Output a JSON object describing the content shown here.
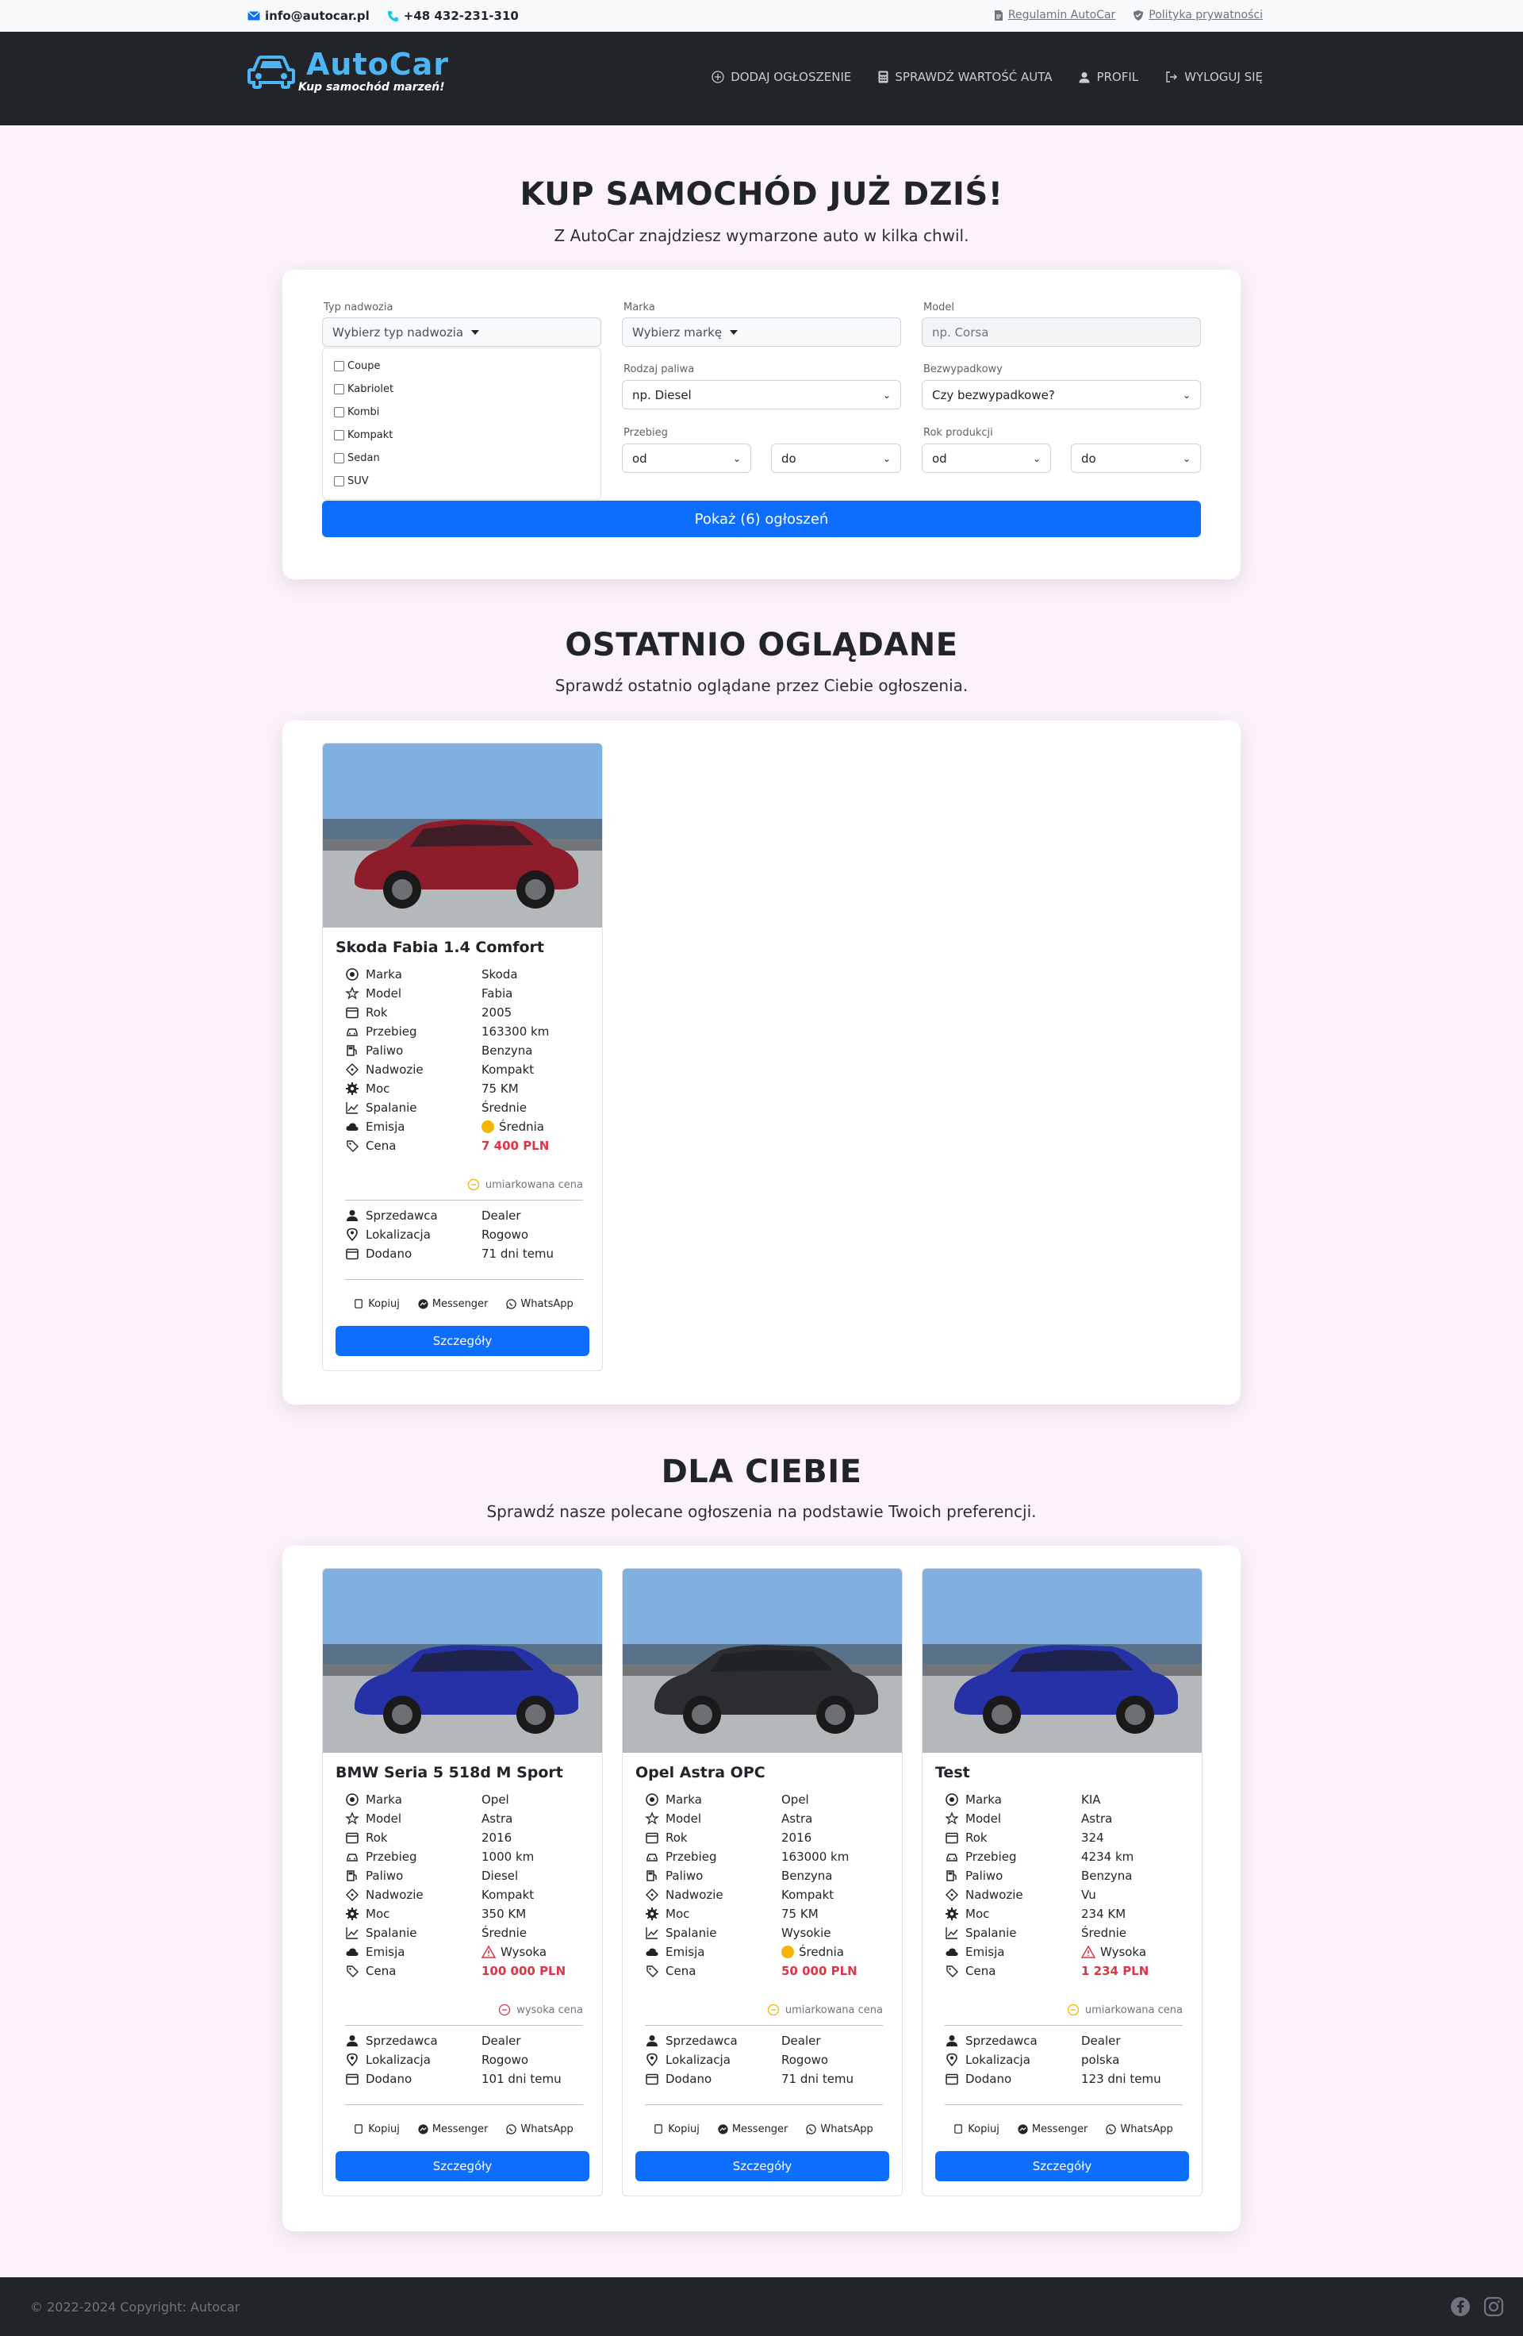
{
  "topbar": {
    "email": "info@autocar.pl",
    "phone": "+48 432-231-310",
    "terms": "Regulamin AutoCar",
    "privacy": "Polityka prywatności"
  },
  "brand": {
    "name": "AutoCar",
    "tagline": "Kup samochód marzeń!",
    "accent": "#4cb5f5"
  },
  "nav": {
    "add": "DODAJ OGŁOSZENIE",
    "value": "SPRAWDŹ WARTOŚĆ AUTA",
    "profile": "PROFIL",
    "logout": "WYLOGUJ SIĘ"
  },
  "hero": {
    "title": "KUP SAMOCHÓD JUŻ DZIŚ!",
    "subtitle": "Z AutoCar znajdziesz wymarzone auto w kilka chwil."
  },
  "search": {
    "body_label": "Typ nadwozia",
    "body_value": "Wybierz typ nadwozia",
    "body_options": [
      "Coupe",
      "Kabriolet",
      "Kombi",
      "Kompakt",
      "Sedan",
      "SUV"
    ],
    "brand_label": "Marka",
    "brand_value": "Wybierz markę",
    "model_label": "Model",
    "model_placeholder": "np. Corsa",
    "fuel_label": "Rodzaj paliwa",
    "fuel_value": "np. Diesel",
    "accident_label": "Bezwypadkowy",
    "accident_value": "Czy bezwypadkowe?",
    "mileage_label": "Przebieg",
    "mileage_from": "od",
    "mileage_to": "do",
    "year_label": "Rok produkcji",
    "year_from": "od",
    "year_to": "do",
    "submit": "Pokaż (6) ogłoszeń"
  },
  "recent": {
    "title": "OSTATNIO OGLĄDANE",
    "subtitle": "Sprawdź ostatnio oglądane przez Ciebie ogłoszenia."
  },
  "foryou": {
    "title": "DLA CIEBIE",
    "subtitle": "Sprawdź nasze polecane ogłoszenia na podstawie Twoich preferencji."
  },
  "labels": {
    "marka": "Marka",
    "model": "Model",
    "rok": "Rok",
    "przebieg": "Przebieg",
    "paliwo": "Paliwo",
    "nadwozie": "Nadwozie",
    "moc": "Moc",
    "spalanie": "Spalanie",
    "emisja": "Emisja",
    "cena": "Cena",
    "sprzedawca": "Sprzedawca",
    "lokalizacja": "Lokalizacja",
    "dodano": "Dodano",
    "copy": "Kopiuj",
    "messenger": "Messenger",
    "whatsapp": "WhatsApp",
    "details": "Szczegóły"
  },
  "cards": [
    {
      "title": "Skoda Fabia 1.4 Comfort",
      "marka": "Skoda",
      "model": "Fabia",
      "rok": "2005",
      "przebieg": "163300 km",
      "paliwo": "Benzyna",
      "nadwozie": "Kompakt",
      "moc": "75 KM",
      "spalanie": "Średnie",
      "emisja": "Średnia",
      "emisja_icon": "yellow-dot-icon",
      "cena": "7 400 PLN",
      "note": "umiarkowana cena",
      "sprzedawca": "Dealer",
      "lokalizacja": "Rogowo",
      "dodano": "71 dni temu",
      "car_color": "#8e1d2c"
    },
    {
      "title": "BMW Seria 5 518d M Sport",
      "marka": "Opel",
      "model": "Astra",
      "rok": "2016",
      "przebieg": "1000 km",
      "paliwo": "Diesel",
      "nadwozie": "Kompakt",
      "moc": "350 KM",
      "spalanie": "Średnie",
      "emisja": "Wysoka",
      "emisja_icon": "warning-triangle-icon",
      "cena": "100 000 PLN",
      "note": "wysoka cena",
      "sprzedawca": "Dealer",
      "lokalizacja": "Rogowo",
      "dodano": "101 dni temu",
      "car_color": "#2631a8"
    },
    {
      "title": "Opel Astra OPC",
      "marka": "Opel",
      "model": "Astra",
      "rok": "2016",
      "przebieg": "163000 km",
      "paliwo": "Benzyna",
      "nadwozie": "Kompakt",
      "moc": "75 KM",
      "spalanie": "Wysokie",
      "emisja": "Średnia",
      "emisja_icon": "yellow-dot-icon",
      "cena": "50 000 PLN",
      "note": "umiarkowana cena",
      "sprzedawca": "Dealer",
      "lokalizacja": "Rogowo",
      "dodano": "71 dni temu",
      "car_color": "#2b2d30"
    },
    {
      "title": "Test",
      "marka": "KIA",
      "model": "Astra",
      "rok": "324",
      "przebieg": "4234 km",
      "paliwo": "Benzyna",
      "nadwozie": "Vu",
      "moc": "234 KM",
      "spalanie": "Średnie",
      "emisja": "Wysoka",
      "emisja_icon": "warning-triangle-icon",
      "cena": "1 234 PLN",
      "note": "umiarkowana cena",
      "sprzedawca": "Dealer",
      "lokalizacja": "polska",
      "dodano": "123 dni temu",
      "car_color": "#2631a8"
    }
  ],
  "footer": {
    "copyright": "© 2022-2024 Copyright: Autocar"
  }
}
